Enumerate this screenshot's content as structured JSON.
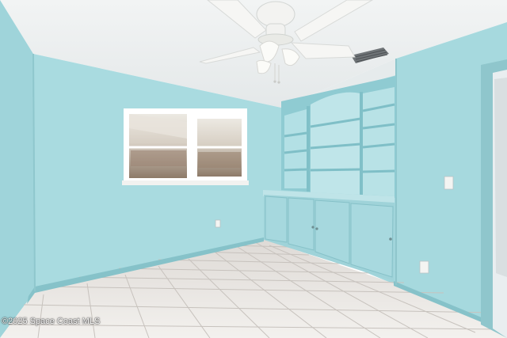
{
  "photo": {
    "watermark_text": "©2025 Space Coast MLS",
    "colors": {
      "ceiling": "#eef1f2",
      "wall": "#a9dbe0",
      "wall_shadow": "#97ccd3",
      "trim": "#86c2c9",
      "cabinet": "#a3d6dc",
      "floor": "#e9e6e3",
      "grout": "#c8c3bf",
      "fan": "#f6f6f4",
      "window_frame": "#ffffff"
    }
  }
}
